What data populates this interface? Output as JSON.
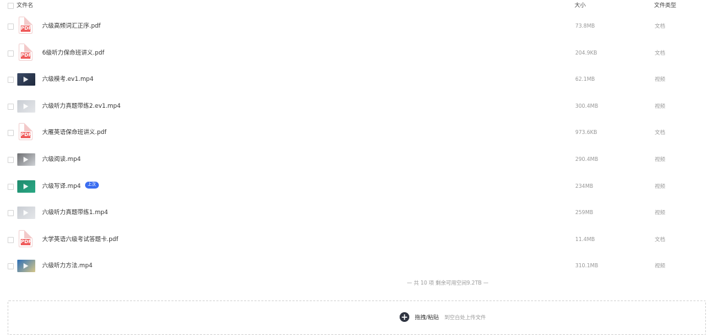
{
  "header": {
    "name": "文件名",
    "size": "大小",
    "type": "文件类型"
  },
  "files": [
    {
      "name": "六级高频词汇正序.pdf",
      "size": "73.8MB",
      "type": "文档",
      "icon": "pdf",
      "badge": ""
    },
    {
      "name": "6级听力保命班讲义.pdf",
      "size": "204.9KB",
      "type": "文档",
      "icon": "pdf",
      "badge": ""
    },
    {
      "name": "六级模考.ev1.mp4",
      "size": "62.1MB",
      "type": "视频",
      "icon": "video-dark",
      "badge": ""
    },
    {
      "name": "六级听力真题带练2.ev1.mp4",
      "size": "300.4MB",
      "type": "视频",
      "icon": "video-light",
      "badge": ""
    },
    {
      "name": "大雁英语保命班讲义.pdf",
      "size": "973.6KB",
      "type": "文档",
      "icon": "pdf",
      "badge": ""
    },
    {
      "name": "六级阅读.mp4",
      "size": "290.4MB",
      "type": "视频",
      "icon": "video-person",
      "badge": ""
    },
    {
      "name": "六级写译.mp4",
      "size": "234MB",
      "type": "视频",
      "icon": "video-green",
      "badge": "上次"
    },
    {
      "name": "六级听力真题带练1.mp4",
      "size": "259MB",
      "type": "视频",
      "icon": "video-light",
      "badge": ""
    },
    {
      "name": "大学英语六级考试答题卡.pdf",
      "size": "11.4MB",
      "type": "文档",
      "icon": "pdf",
      "badge": ""
    },
    {
      "name": "六级听力方法.mp4",
      "size": "310.1MB",
      "type": "视频",
      "icon": "video-blue",
      "badge": ""
    }
  ],
  "summary": "— 共 10 项  剩余可用空间9.2TB —",
  "upload": {
    "action": "拖拽/粘贴",
    "hint": "到空白处上传文件"
  },
  "pdf_label": "PDF"
}
